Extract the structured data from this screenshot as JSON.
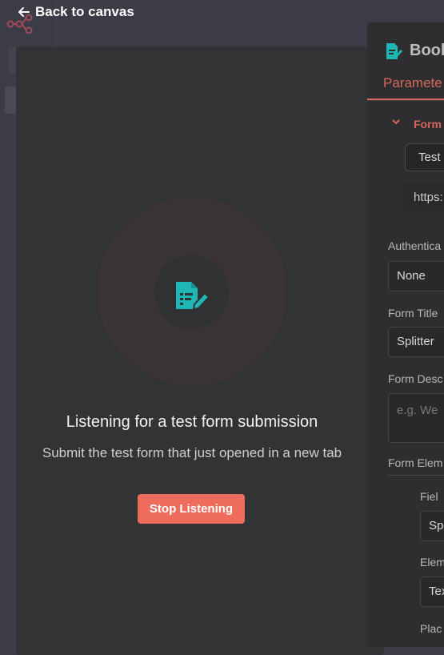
{
  "header": {
    "back_label": "Back to canvas"
  },
  "listening": {
    "title": "Listening for a test form submission",
    "subtitle": "Submit the test form that just opened in a new tab",
    "stop_button": "Stop Listening"
  },
  "node_panel": {
    "title": "Book",
    "tab": "Paramete",
    "form_url_section": "Form",
    "url_toggle": "Test",
    "url_value": "https:",
    "fields": [
      {
        "label": "Authentica",
        "value": "None"
      },
      {
        "label": "Form Title",
        "value": "Splitter"
      },
      {
        "label": "Form Desc",
        "placeholder": "e.g. We"
      }
    ],
    "elements_section": "Form Elem",
    "sub_fields": [
      {
        "label": "Fiel",
        "value": "Sp"
      },
      {
        "label": "Elem",
        "value": "Tex"
      },
      {
        "label": "Plac",
        "value": ""
      }
    ]
  },
  "colors": {
    "accent": "#ee6c5c",
    "icon_teal": "#1fb6b6",
    "panel": "#323335",
    "canvas": "#3c3c46"
  },
  "icons": [
    "back-arrow-icon",
    "n8n-logo-icon",
    "form-icon",
    "chevron-down-icon"
  ]
}
